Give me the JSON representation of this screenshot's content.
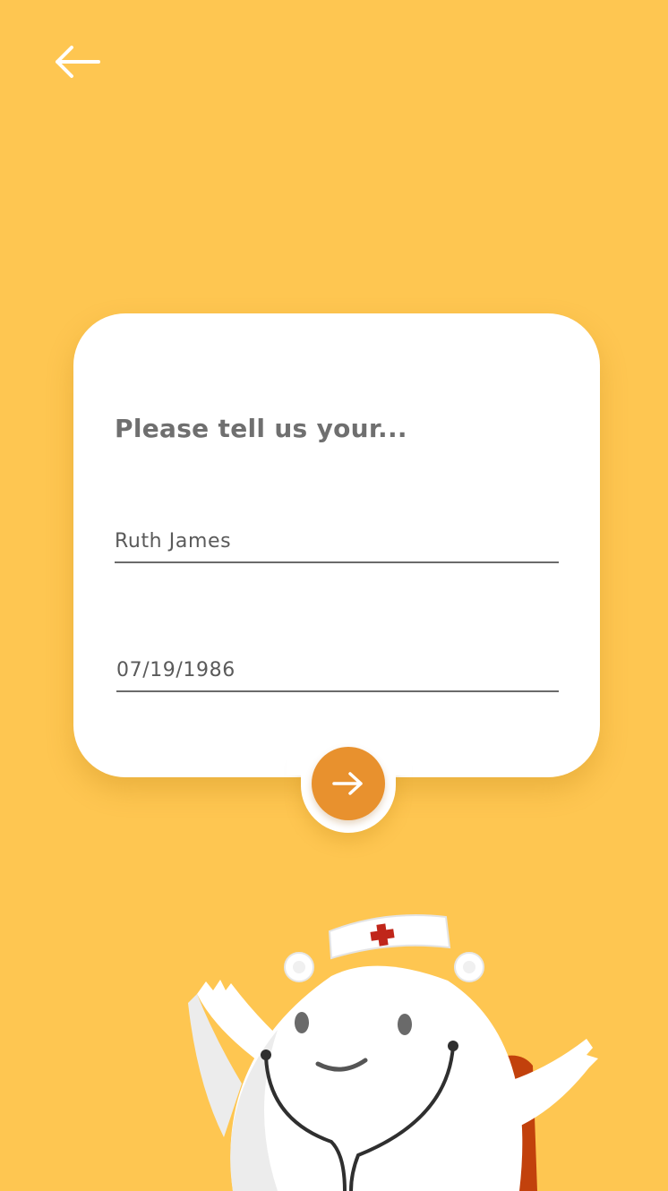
{
  "header": {
    "back_icon": "arrow-left-icon"
  },
  "form": {
    "prompt": "Please tell us your...",
    "name_value": "Ruth James",
    "dob_value": "07/19/1986"
  },
  "actions": {
    "next_icon": "arrow-right-icon"
  },
  "colors": {
    "background": "#FEC651",
    "card": "#FFFFFF",
    "accent": "#E8912E",
    "text": "#6F6F6F"
  },
  "mascot": {
    "icon": "nurse-bear-mascot"
  }
}
